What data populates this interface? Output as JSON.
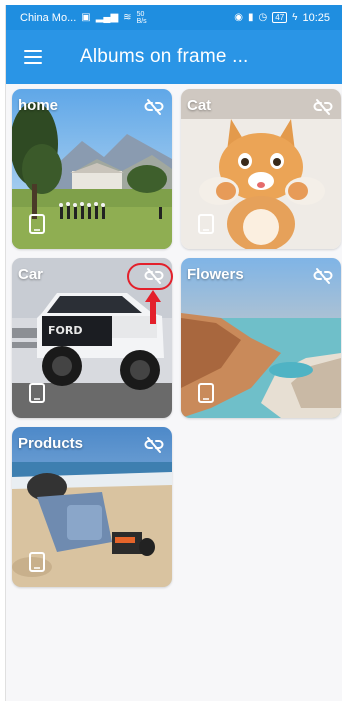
{
  "status_bar": {
    "carrier": "China Mo...",
    "speed_value": "50",
    "speed_unit": "B/s",
    "battery": "47",
    "time": "10:25"
  },
  "app_bar": {
    "menu_icon": "hamburger-menu-icon",
    "title": "Albums on frame ..."
  },
  "albums": [
    {
      "name": "home",
      "link_icon": "unlink-icon",
      "device_icon": "phone-icon"
    },
    {
      "name": "Cat",
      "link_icon": "unlink-icon",
      "device_icon": "phone-icon"
    },
    {
      "name": "Car",
      "link_icon": "unlink-icon",
      "device_icon": "phone-icon",
      "highlighted": true
    },
    {
      "name": "Flowers",
      "link_icon": "unlink-icon",
      "device_icon": "phone-icon"
    },
    {
      "name": "Products",
      "link_icon": "unlink-icon",
      "device_icon": "phone-icon"
    }
  ],
  "annotation": {
    "color": "#e3202b",
    "target": "Car unlink icon"
  }
}
